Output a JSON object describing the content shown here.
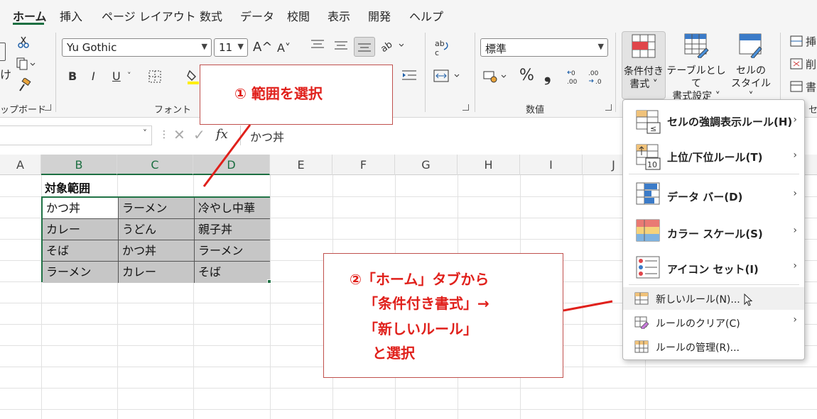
{
  "tabs": [
    "ホーム",
    "挿入",
    "ページ レイアウト",
    "数式",
    "データ",
    "校閲",
    "表示",
    "開発",
    "ヘルプ"
  ],
  "ribbon": {
    "clipboard": {
      "paste_label": "け",
      "group_label": "ップボード"
    },
    "font": {
      "font_name": "Yu Gothic",
      "font_size": "11",
      "grow_label": "A^",
      "shrink_label": "A˅",
      "bold": "B",
      "italic": "I",
      "underline": "U",
      "group_label": "フォント"
    },
    "number": {
      "format": "標準",
      "percent": "%",
      "comma": "❟",
      "group_label": "数値"
    },
    "styles": {
      "conditional_format_line1": "条件付き",
      "conditional_format_line2": "書式 ˅",
      "table_format_line1": "テーブルとして",
      "table_format_line2": "書式設定 ˅",
      "cell_style_line1": "セルの",
      "cell_style_line2": "スタイル ˅"
    },
    "cells": {
      "insert": "挿",
      "delete": "削",
      "format": "書",
      "group_label": "セ"
    }
  },
  "formula_bar": {
    "fx": "fx",
    "value": "かつ丼"
  },
  "columns": [
    "A",
    "B",
    "C",
    "D",
    "E",
    "F",
    "G",
    "H",
    "I",
    "J"
  ],
  "sheet": {
    "title": "対象範囲",
    "table": [
      [
        "かつ丼",
        "ラーメン",
        "冷やし中華"
      ],
      [
        "カレー",
        "うどん",
        "親子丼"
      ],
      [
        "そば",
        "かつ丼",
        "ラーメン"
      ],
      [
        "ラーメン",
        "カレー",
        "そば"
      ]
    ]
  },
  "menu": {
    "items": [
      {
        "label": "セルの強調表示ルール(H)",
        "icon": "highlight-rules-icon"
      },
      {
        "label": "上位/下位ルール(T)",
        "icon": "top-bottom-icon"
      },
      {
        "label": "データ バー(D)",
        "icon": "data-bar-icon"
      },
      {
        "label": "カラー スケール(S)",
        "icon": "color-scale-icon"
      },
      {
        "label": "アイコン セット(I)",
        "icon": "icon-set-icon"
      }
    ],
    "small_items": [
      {
        "label": "新しいルール(N)...",
        "icon": "new-rule-icon"
      },
      {
        "label": "ルールのクリア(C)",
        "icon": "clear-rules-icon"
      },
      {
        "label": "ルールの管理(R)...",
        "icon": "manage-rules-icon"
      }
    ]
  },
  "annotations": {
    "step1": "① 範囲を選択",
    "step2_lines": [
      "②「ホーム」タブから",
      "「条件付き書式」→",
      "「新しいルール」",
      "と選択"
    ]
  },
  "colors": {
    "accent": "#1d6f42",
    "annotation": "#e0201b",
    "selection_fill": "#c6c6c6"
  }
}
